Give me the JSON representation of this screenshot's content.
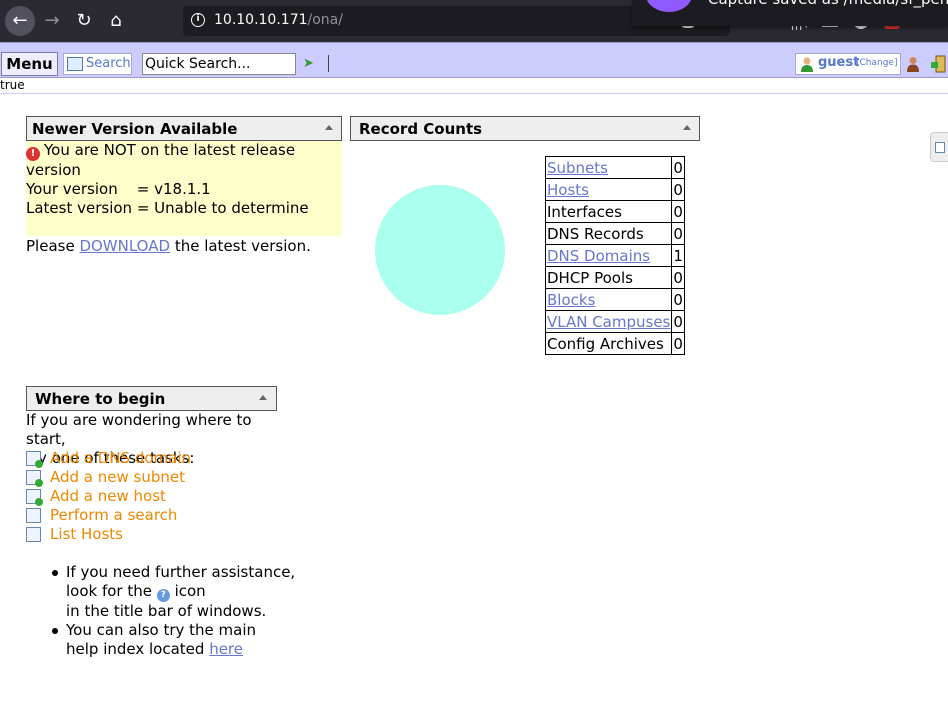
{
  "browser": {
    "url_host": "10.10.10.171",
    "url_path": "/ona/",
    "notification": "Capture saved as /media/sf_pentest"
  },
  "toolbar": {
    "menu_label": "Menu",
    "search_label": "Search",
    "quick_search_value": "Quick Search...",
    "user_name": "guest",
    "change_label": "[Change]"
  },
  "debug_text": "true",
  "version_panel": {
    "title": "Newer Version Available",
    "warning": "You are NOT on the latest release version",
    "your_version": "Your version    = v18.1.1",
    "latest_version": "Latest version = Unable to determine",
    "download_prefix": "Please ",
    "download_link": "DOWNLOAD",
    "download_suffix": " the latest version."
  },
  "counts_panel": {
    "title": "Record Counts",
    "rows": [
      {
        "label": "Subnets",
        "count": "0",
        "link": true
      },
      {
        "label": "Hosts",
        "count": "0",
        "link": true
      },
      {
        "label": "Interfaces",
        "count": "0",
        "link": false
      },
      {
        "label": "DNS Records",
        "count": "0",
        "link": false
      },
      {
        "label": "DNS Domains",
        "count": "1",
        "link": true
      },
      {
        "label": "DHCP Pools",
        "count": "0",
        "link": false
      },
      {
        "label": "Blocks",
        "count": "0",
        "link": true
      },
      {
        "label": "VLAN Campuses",
        "count": "0",
        "link": true
      },
      {
        "label": "Config Archives",
        "count": "0",
        "link": false
      }
    ]
  },
  "begin_panel": {
    "title": "Where to begin",
    "intro_line1": "If you are wondering where to start,",
    "intro_line2": "try one of these tasks:",
    "tasks": [
      {
        "label": "Add a DNS domain",
        "icon": "add-dns-domain-icon"
      },
      {
        "label": "Add a new subnet",
        "icon": "add-subnet-icon"
      },
      {
        "label": "Add a new host",
        "icon": "add-host-icon"
      },
      {
        "label": "Perform a search",
        "icon": "search-icon"
      },
      {
        "label": "List Hosts",
        "icon": "list-hosts-icon"
      }
    ],
    "tip1_line1": "If you need further assistance,",
    "tip1_line2_prefix": "look for the",
    "tip1_line2_suffix": "icon",
    "tip1_line3": "in the title bar of windows.",
    "tip2_line1": "You can also try the main",
    "tip2_line2_prefix": "help index located ",
    "tip2_link": "here"
  },
  "colors": {
    "toolbar_bg": "#ccccff",
    "warning_bg": "#ffffcc",
    "task_link": "#ee8800",
    "link": "#6677cc",
    "circle": "#aaffee"
  }
}
